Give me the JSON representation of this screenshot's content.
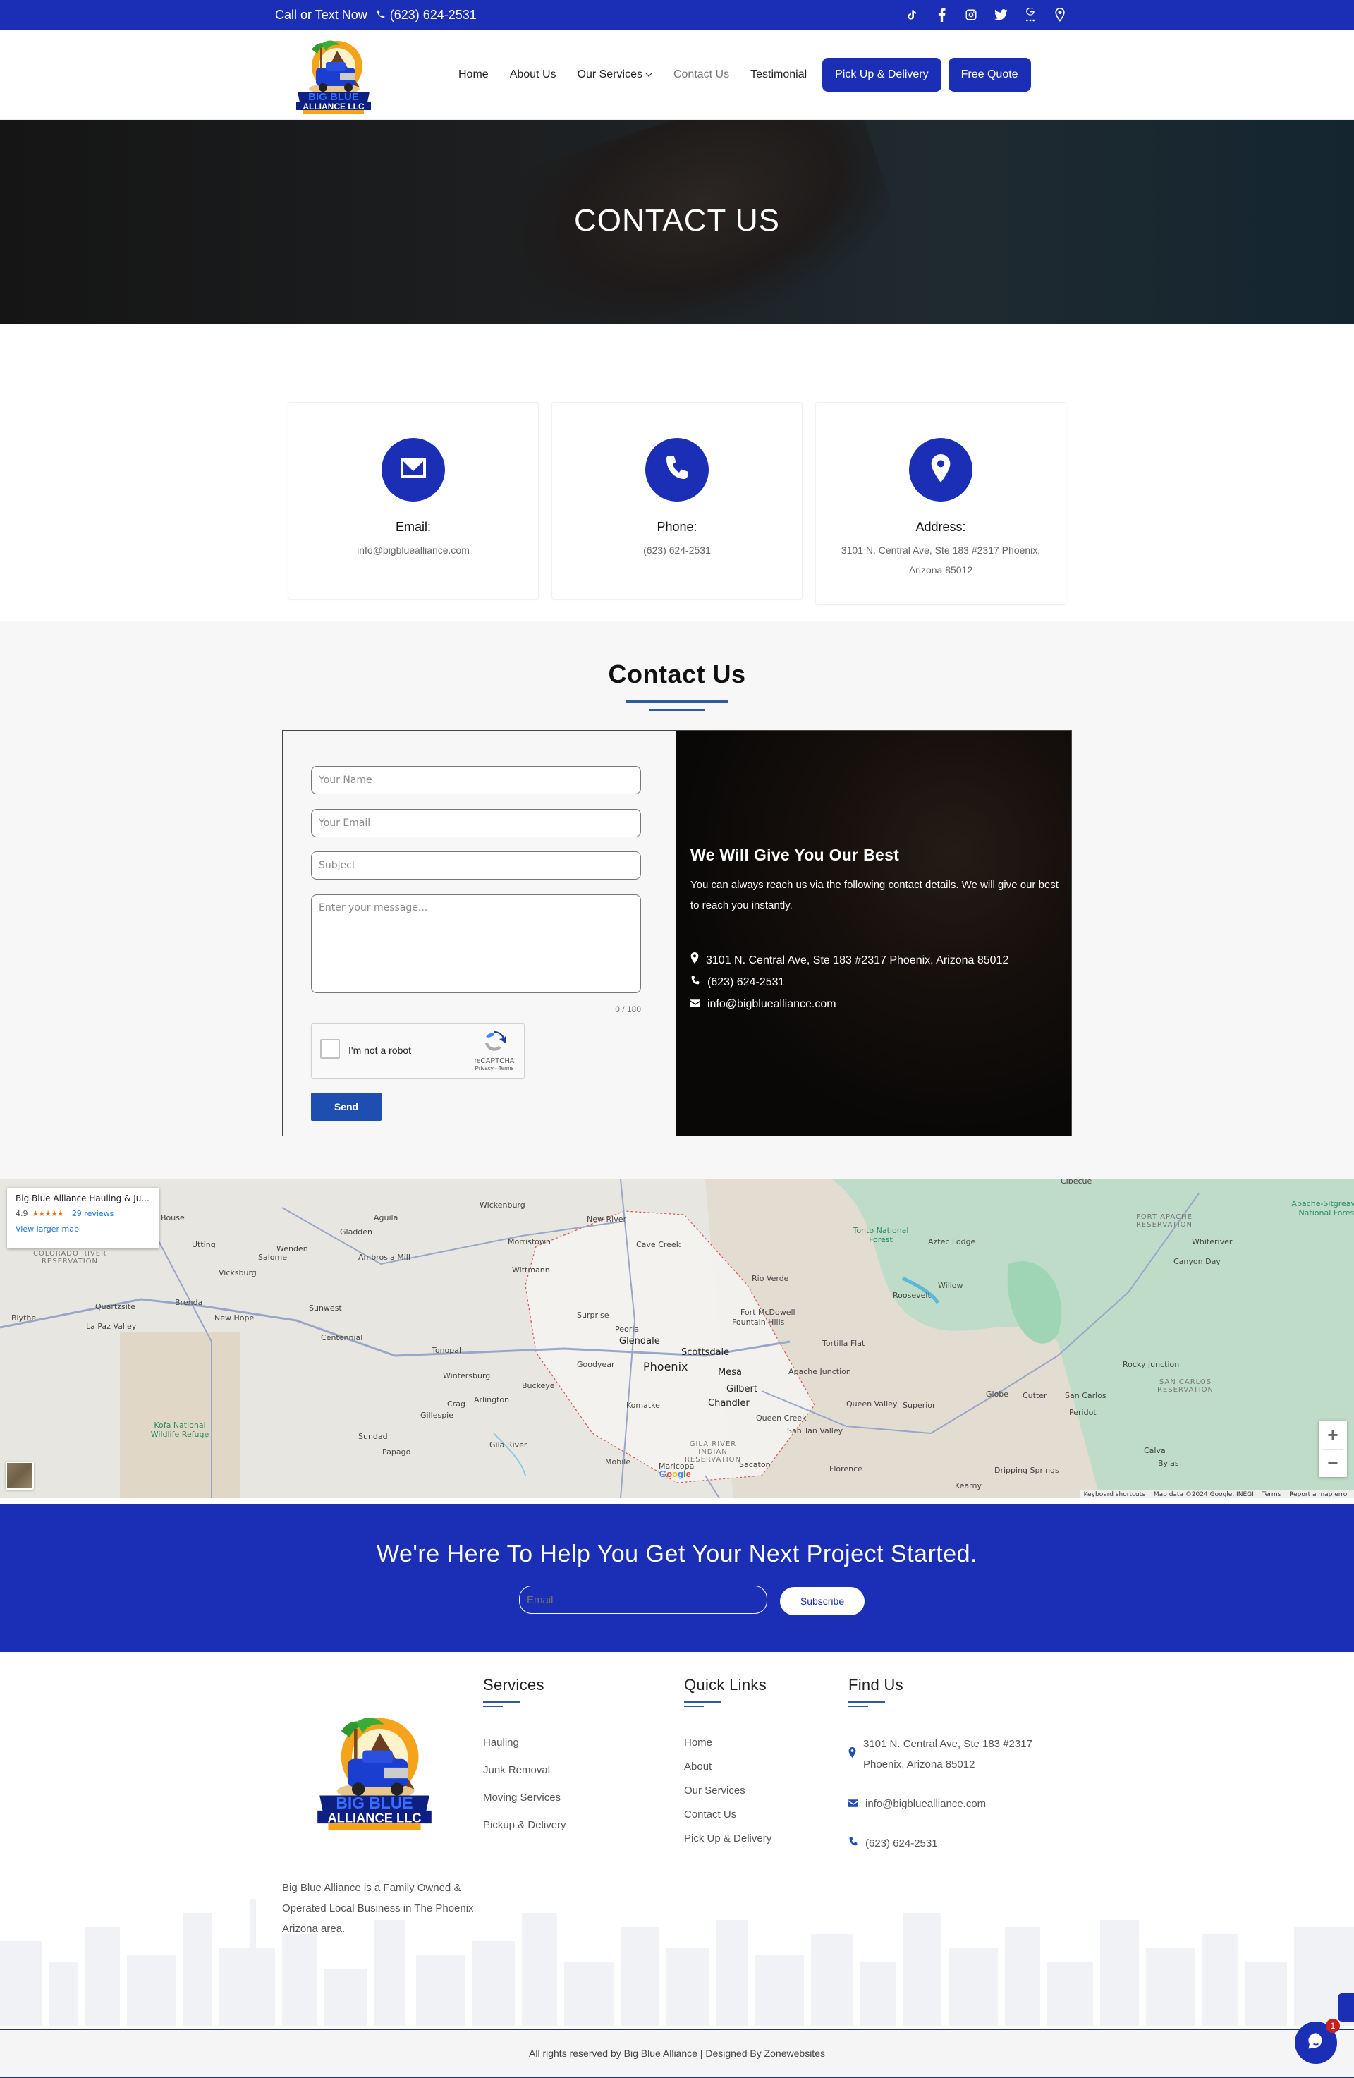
{
  "topbar": {
    "call_label": "Call or Text Now",
    "phone": "(623) 624-2531",
    "socials": [
      "tiktok-icon",
      "facebook-icon",
      "instagram-icon",
      "twitter-icon",
      "google-reviews-icon",
      "location-pin-icon"
    ]
  },
  "nav": {
    "logo_alt": "Big Blue Alliance LLC - Hauling and Junk Removal Services",
    "items": [
      {
        "label": "Home"
      },
      {
        "label": "About Us"
      },
      {
        "label": "Our Services",
        "has_dropdown": true
      },
      {
        "label": "Contact Us",
        "active": true
      },
      {
        "label": "Testimonial"
      }
    ],
    "buttons": [
      {
        "label": "Pick Up & Delivery"
      },
      {
        "label": "Free Quote"
      }
    ]
  },
  "hero": {
    "title": "CONTACT US"
  },
  "info_cards": [
    {
      "icon": "envelope-icon",
      "title": "Email:",
      "value": "info@bigbluealliance.com"
    },
    {
      "icon": "phone-icon",
      "title": "Phone:",
      "value": "(623) 624-2531"
    },
    {
      "icon": "map-pin-icon",
      "title": "Address:",
      "value": "3101 N. Central Ave, Ste 183 #2317 Phoenix, Arizona 85012"
    }
  ],
  "contact": {
    "title": "Contact Us",
    "form": {
      "name_placeholder": "Your Name",
      "email_placeholder": "Your Email",
      "subject_placeholder": "Subject",
      "message_placeholder": "Enter your message...",
      "counter": "0 / 180",
      "captcha_label": "I'm not a robot",
      "captcha_brand": "reCAPTCHA",
      "captcha_links": "Privacy - Terms",
      "send_label": "Send"
    },
    "panel": {
      "heading": "We Will Give You Our Best",
      "text": "You can always reach us via the following contact details. We will give our best to reach you instantly.",
      "address": "3101 N. Central Ave, Ste 183 #2317 Phoenix, Arizona 85012",
      "phone": "(623) 624-2531",
      "email": "info@bigbluealliance.com"
    }
  },
  "map": {
    "card": {
      "name": "Big Blue Alliance Hauling & Ju...",
      "rating": "4.9",
      "stars": "★★★★★",
      "reviews": "29 reviews",
      "larger_map": "View larger map"
    },
    "zoom_in": "+",
    "zoom_out": "−",
    "attribution": [
      "Keyboard shortcuts",
      "Map data ©2024 Google, INEGI",
      "Terms",
      "Report a map error"
    ],
    "google": "Google",
    "places": [
      {
        "name": "Bouse",
        "cls": ""
      },
      {
        "name": "Aguila",
        "cls": ""
      },
      {
        "name": "Gladden",
        "cls": ""
      },
      {
        "name": "Wickenburg",
        "cls": ""
      },
      {
        "name": "Utting",
        "cls": ""
      },
      {
        "name": "Wenden",
        "cls": ""
      },
      {
        "name": "Salome",
        "cls": ""
      },
      {
        "name": "Ambrosia Mill",
        "cls": ""
      },
      {
        "name": "Morristown",
        "cls": ""
      },
      {
        "name": "New River",
        "cls": ""
      },
      {
        "name": "Cave Creek",
        "cls": ""
      },
      {
        "name": "Vicksburg",
        "cls": ""
      },
      {
        "name": "Wittmann",
        "cls": ""
      },
      {
        "name": "Quartzsite",
        "cls": ""
      },
      {
        "name": "Brenda",
        "cls": ""
      },
      {
        "name": "Sunwest",
        "cls": ""
      },
      {
        "name": "Rio Verde",
        "cls": ""
      },
      {
        "name": "Blythe",
        "cls": ""
      },
      {
        "name": "New Hope",
        "cls": ""
      },
      {
        "name": "Surprise",
        "cls": ""
      },
      {
        "name": "Fort McDowell",
        "cls": ""
      },
      {
        "name": "Fountain Hills",
        "cls": ""
      },
      {
        "name": "La Paz Valley",
        "cls": ""
      },
      {
        "name": "Centennial",
        "cls": ""
      },
      {
        "name": "Peoria",
        "cls": ""
      },
      {
        "name": "Glendale",
        "cls": "mid"
      },
      {
        "name": "Tortilla Flat",
        "cls": ""
      },
      {
        "name": "Tonopah",
        "cls": ""
      },
      {
        "name": "Scottsdale",
        "cls": "mid"
      },
      {
        "name": "Phoenix",
        "cls": "big"
      },
      {
        "name": "Goodyear",
        "cls": ""
      },
      {
        "name": "Wintersburg",
        "cls": ""
      },
      {
        "name": "Mesa",
        "cls": "mid"
      },
      {
        "name": "Apache Junction",
        "cls": ""
      },
      {
        "name": "Buckeye",
        "cls": ""
      },
      {
        "name": "Gilbert",
        "cls": "mid"
      },
      {
        "name": "Arlington",
        "cls": ""
      },
      {
        "name": "Chandler",
        "cls": "mid"
      },
      {
        "name": "Crag",
        "cls": ""
      },
      {
        "name": "Komatke",
        "cls": ""
      },
      {
        "name": "Gillespie",
        "cls": ""
      },
      {
        "name": "Queen Creek",
        "cls": ""
      },
      {
        "name": "Queen Valley",
        "cls": ""
      },
      {
        "name": "Superior",
        "cls": ""
      },
      {
        "name": "Sundad",
        "cls": ""
      },
      {
        "name": "San Tan Valley",
        "cls": ""
      },
      {
        "name": "Papago",
        "cls": ""
      },
      {
        "name": "Mobile",
        "cls": ""
      },
      {
        "name": "Maricopa",
        "cls": ""
      },
      {
        "name": "Sacaton",
        "cls": ""
      },
      {
        "name": "Florence",
        "cls": ""
      },
      {
        "name": "Roosevelt",
        "cls": ""
      },
      {
        "name": "Willow",
        "cls": ""
      },
      {
        "name": "Aztec Lodge",
        "cls": ""
      },
      {
        "name": "Globe",
        "cls": ""
      },
      {
        "name": "Cutter",
        "cls": ""
      },
      {
        "name": "San Carlos",
        "cls": ""
      },
      {
        "name": "Peridot",
        "cls": ""
      },
      {
        "name": "Rocky Junction",
        "cls": ""
      },
      {
        "name": "Whiteriver",
        "cls": ""
      },
      {
        "name": "Canyon Day",
        "cls": ""
      },
      {
        "name": "Calva",
        "cls": ""
      },
      {
        "name": "Bylas",
        "cls": ""
      },
      {
        "name": "Kearny",
        "cls": ""
      },
      {
        "name": "Dripping Springs",
        "cls": ""
      },
      {
        "name": "Cibecue",
        "cls": ""
      },
      {
        "name": "Tonto National Forest",
        "cls": "green"
      },
      {
        "name": "Kofa National Wildlife Refuge",
        "cls": "green"
      },
      {
        "name": "Apache-Sitgreaves National Forest",
        "cls": "green"
      },
      {
        "name": "COLORADO RIVER RESERVATION",
        "cls": "res"
      },
      {
        "name": "GILA RIVER INDIAN RESERVATION",
        "cls": "res"
      },
      {
        "name": "FORT APACHE RESERVATION",
        "cls": "res"
      },
      {
        "name": "SAN CARLOS RESERVATION",
        "cls": "res"
      },
      {
        "name": "Gila River",
        "cls": ""
      }
    ]
  },
  "cta": {
    "heading": "We're Here To Help You Get Your Next Project Started.",
    "email_placeholder": "Email",
    "subscribe_label": "Subscribe"
  },
  "footer": {
    "about": "Big Blue Alliance is a Family Owned & Operated Local Business in The Phoenix Arizona area.",
    "services": {
      "title": "Services",
      "items": [
        "Hauling",
        "Junk Removal",
        "Moving Services",
        "Pickup & Delivery"
      ]
    },
    "quick_links": {
      "title": "Quick Links",
      "items": [
        "Home",
        "About",
        "Our Services",
        "Contact Us",
        "Pick Up & Delivery"
      ]
    },
    "find_us": {
      "title": "Find Us",
      "address": "3101 N. Central Ave, Ste 183 #2317 Phoenix, Arizona 85012",
      "email": "info@bigbluealliance.com",
      "phone": "(623) 624-2531"
    },
    "copyright": "All rights reserved by Big Blue Alliance | Designed By Zonewebsites"
  },
  "chat": {
    "badge": "1"
  },
  "colors": {
    "brand_blue": "#1a2fb5",
    "button_blue": "#1e4fb0",
    "accent_line": "#2d5aa0",
    "badge_red": "#c62020"
  }
}
